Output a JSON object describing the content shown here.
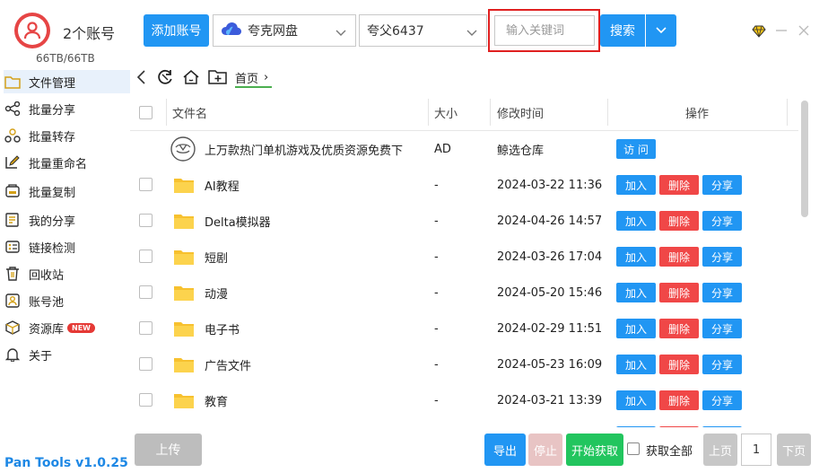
{
  "header": {
    "account_count": "2个账号",
    "storage": "66TB/66TB",
    "add_account_label": "添加账号",
    "drive_selected": "夸克网盘",
    "user_selected": "夸父6437",
    "search_placeholder": "输入关键词",
    "search_label": "搜索"
  },
  "sidebar": {
    "items": [
      {
        "label": "文件管理",
        "icon": "folder-icon"
      },
      {
        "label": "批量分享",
        "icon": "share-icon"
      },
      {
        "label": "批量转存",
        "icon": "transfer-icon"
      },
      {
        "label": "批量重命名",
        "icon": "rename-icon"
      },
      {
        "label": "批量复制",
        "icon": "copy-icon"
      },
      {
        "label": "我的分享",
        "icon": "my-share-icon"
      },
      {
        "label": "链接检测",
        "icon": "link-check-icon"
      },
      {
        "label": "回收站",
        "icon": "trash-icon"
      },
      {
        "label": "账号池",
        "icon": "account-pool-icon"
      },
      {
        "label": "资源库",
        "icon": "library-icon",
        "badge": "NEW"
      },
      {
        "label": "关于",
        "icon": "bell-icon"
      }
    ],
    "version": "Pan Tools v1.0.25"
  },
  "pathbar": {
    "breadcrumb": "首页",
    "separator": "›"
  },
  "table": {
    "headers": {
      "name": "文件名",
      "size": "大小",
      "modified": "修改时间",
      "actions": "操作"
    },
    "ad_row": {
      "name": "上万款热门单机游戏及优质资源免费下",
      "size": "AD",
      "modified": "鲸选仓库",
      "action": "访 问"
    },
    "rows": [
      {
        "name": "AI教程",
        "size": "-",
        "modified": "2024-03-22 11:36"
      },
      {
        "name": "Delta模拟器",
        "size": "-",
        "modified": "2024-04-26 14:57"
      },
      {
        "name": "短剧",
        "size": "-",
        "modified": "2024-03-26 17:04"
      },
      {
        "name": "动漫",
        "size": "-",
        "modified": "2024-05-20 15:46"
      },
      {
        "name": "电子书",
        "size": "-",
        "modified": "2024-02-29 11:51"
      },
      {
        "name": "广告文件",
        "size": "-",
        "modified": "2024-05-23 16:09"
      },
      {
        "name": "教育",
        "size": "-",
        "modified": "2024-03-21 13:39"
      }
    ],
    "ops": {
      "join": "加入",
      "delete": "删除",
      "share": "分享"
    }
  },
  "bottom": {
    "upload": "上传",
    "export": "导出",
    "stop": "停止",
    "fetch": "开始获取",
    "fetch_all": "获取全部",
    "prev": "上页",
    "page": "1",
    "next": "下页"
  },
  "colors": {
    "primary": "#2196f3",
    "danger": "#f04747",
    "success": "#22c55e",
    "highlight_border": "#e02020"
  }
}
